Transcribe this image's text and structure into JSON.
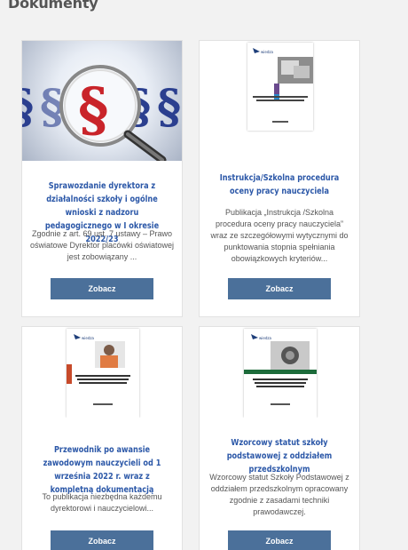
{
  "section": {
    "title": "Dokumenty"
  },
  "cards": [
    {
      "title": "Sprawozdanie dyrektora z działalności szkoły i ogólne wnioski z nadzoru pedagogicznego w I okresie 2022/23",
      "description": "Zgodnie z art. 69 ust. 7 ustawy – Prawo oświatowe Dyrektor placówki oświatowej jest zobowiązany ...",
      "button": "Zobacz"
    },
    {
      "title": "Instrukcja/Szkolna procedura oceny pracy nauczyciela",
      "description": "Publikacja „Instrukcja /Szkolna procedura oceny pracy nauczyciela” wraz ze szczegółowymi wytycznymi do punktowania stopnia spełniania obowiązkowych kryteriów...",
      "button": "Zobacz",
      "cover_text": "Instrukcja/Szkolna procedura oceny pracy nauczyciela"
    },
    {
      "title": "Przewodnik po awansie zawodowym nauczycieli od 1 września 2022 r. wraz z kompletną dokumentacją",
      "description": "To publikacja niezbędna każdemu dyrektorowi i nauczycielowi...",
      "button": "Zobacz"
    },
    {
      "title": "Wzorcowy statut szkoły podstawowej z oddziałem przedszkolnym",
      "description": "Wzorcowy statut Szkoły Podstawowej z oddziałem przedszkolnym opracowany zgodnie z zasadami techniki prawodawczej.",
      "button": "Zobacz"
    }
  ]
}
